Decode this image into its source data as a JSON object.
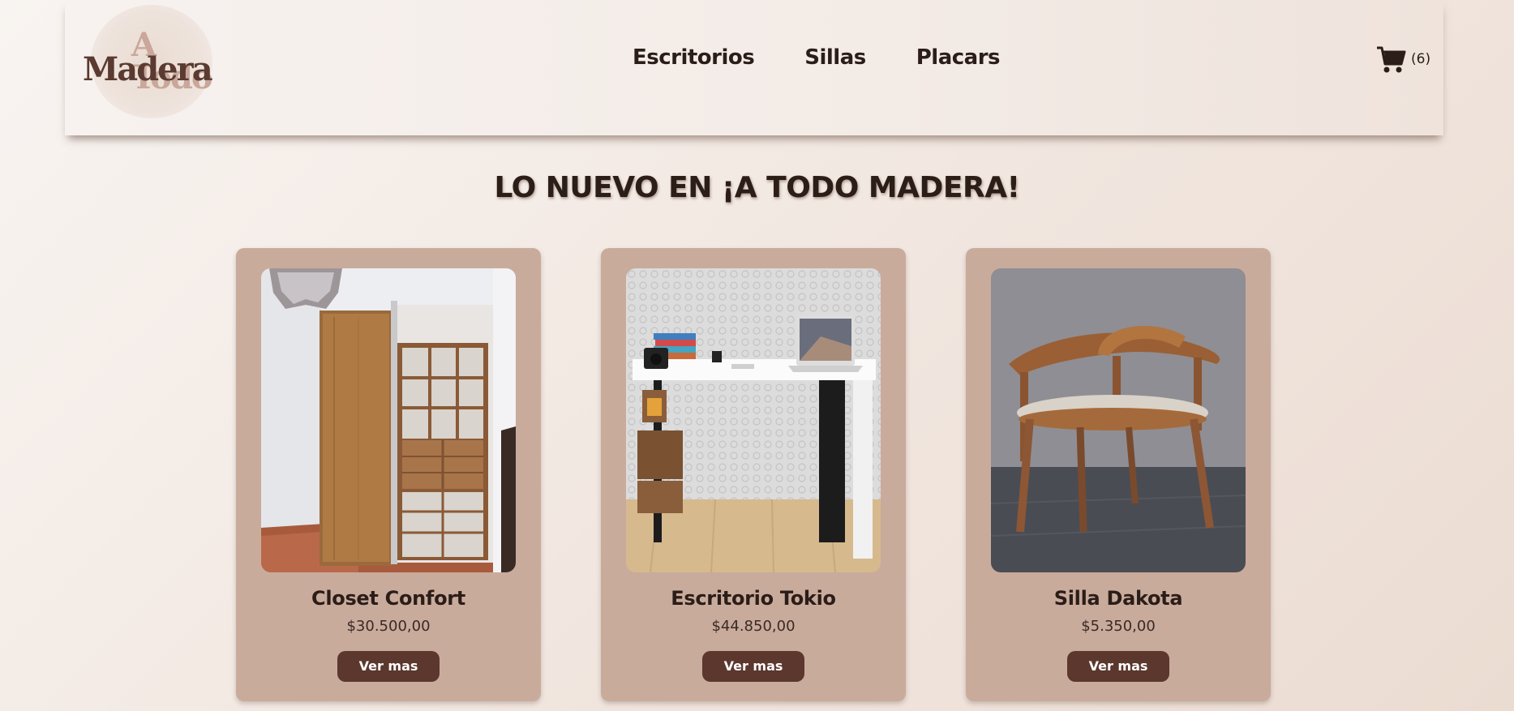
{
  "brand": {
    "logo_line1": "A Todo",
    "logo_line2": "Madera"
  },
  "nav": {
    "items": [
      {
        "label": "Escritorios"
      },
      {
        "label": "Sillas"
      },
      {
        "label": "Placars"
      }
    ]
  },
  "cart": {
    "count": "(6)",
    "icon": "cart-icon"
  },
  "page": {
    "title": "LO NUEVO EN ¡A TODO MADERA!"
  },
  "products": [
    {
      "name": "Closet Confort",
      "price": "$30.500,00",
      "button": "Ver mas",
      "image": "closet-photo"
    },
    {
      "name": "Escritorio Tokio",
      "price": "$44.850,00",
      "button": "Ver mas",
      "image": "desk-photo"
    },
    {
      "name": "Silla Dakota",
      "price": "$5.350,00",
      "button": "Ver mas",
      "image": "chair-photo"
    }
  ],
  "colors": {
    "accent": "#5b372e",
    "card": "#c9ab9c",
    "text": "#2b1d18"
  }
}
